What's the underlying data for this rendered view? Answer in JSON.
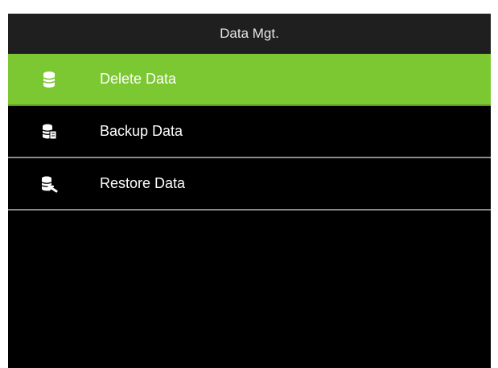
{
  "header": {
    "title": "Data Mgt."
  },
  "menu": {
    "items": [
      {
        "label": "Delete Data",
        "icon": "delete-data-icon",
        "selected": true
      },
      {
        "label": "Backup Data",
        "icon": "backup-data-icon",
        "selected": false
      },
      {
        "label": "Restore Data",
        "icon": "restore-data-icon",
        "selected": false
      }
    ]
  },
  "colors": {
    "selected_bg": "#7cc832",
    "screen_bg": "#000000",
    "title_bg": "#1f1f1f",
    "text": "#ffffff"
  }
}
